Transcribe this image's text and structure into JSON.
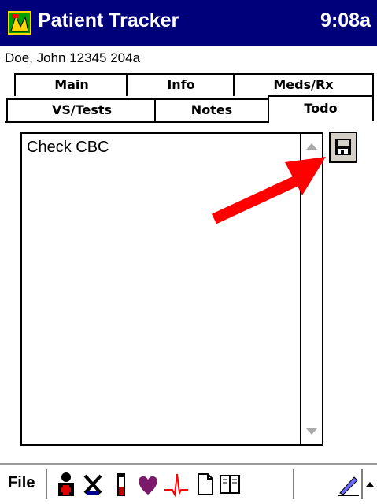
{
  "app": {
    "title": "Patient Tracker",
    "time": "9:08a"
  },
  "patient": {
    "info": "Doe, John 12345 204a"
  },
  "tabs": {
    "row1": [
      "Main",
      "Info",
      "Meds/Rx"
    ],
    "row2": [
      "VS/Tests",
      "Notes",
      "Todo"
    ],
    "active": "Todo"
  },
  "todo": {
    "items": [
      "Check CBC"
    ]
  },
  "menubar": {
    "file": "File"
  },
  "colors": {
    "titlebar": "#00007b",
    "arrow": "#ff0000"
  }
}
